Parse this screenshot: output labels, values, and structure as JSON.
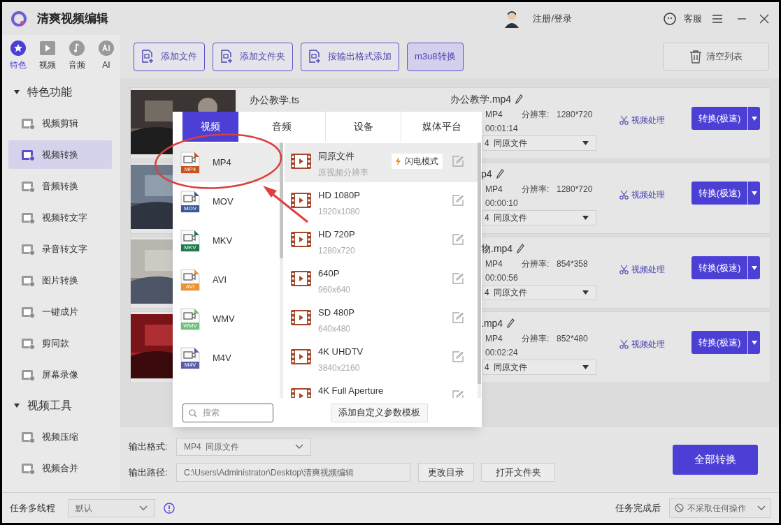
{
  "app": {
    "title": "清爽视频编辑",
    "account": "注册/登录",
    "support": "客服"
  },
  "sidebar": {
    "categories": [
      {
        "label": "特色",
        "selected": true
      },
      {
        "label": "视频",
        "selected": false
      },
      {
        "label": "音频",
        "selected": false
      },
      {
        "label": "AI",
        "selected": false
      }
    ],
    "sections": [
      {
        "title": "特色功能",
        "expanded": true,
        "items": [
          {
            "label": "视频剪辑",
            "selected": false
          },
          {
            "label": "视频转换",
            "selected": true
          },
          {
            "label": "音频转换",
            "selected": false
          },
          {
            "label": "视频转文字",
            "selected": false
          },
          {
            "label": "录音转文字",
            "selected": false
          },
          {
            "label": "图片转换",
            "selected": false
          },
          {
            "label": "一键成片",
            "selected": false
          },
          {
            "label": "剪同款",
            "selected": false
          },
          {
            "label": "屏幕录像",
            "selected": false
          }
        ]
      },
      {
        "title": "视频工具",
        "expanded": true,
        "items": [
          {
            "label": "视频压缩",
            "selected": false
          },
          {
            "label": "视频合并",
            "selected": false
          }
        ]
      }
    ]
  },
  "toolbar": {
    "buttons": [
      {
        "label": "添加文件",
        "kind": "outline"
      },
      {
        "label": "添加文件夹",
        "kind": "outline"
      },
      {
        "label": "按输出格式添加",
        "kind": "outline"
      },
      {
        "label": "m3u8转换",
        "kind": "filled"
      }
    ],
    "clear": "清空列表"
  },
  "files": [
    {
      "name": "办公教学.ts",
      "target": "办公教学.mp4",
      "format": "MP4",
      "resolution_label": "分辨率:",
      "resolution": "1280*720",
      "duration": "00:01:14",
      "preset": "4  同原文件",
      "process": "视频处理",
      "convert": "转换(极速)"
    },
    {
      "target": "p4",
      "format": "MP4",
      "resolution_label": "分辨率:",
      "resolution": "1280*720",
      "duration": "00:00:10",
      "preset": "4  同原文件",
      "process": "视频处理",
      "convert": "转换(极速)"
    },
    {
      "target": "物.mp4",
      "format": "MP4",
      "resolution_label": "分辨率:",
      "resolution": "854*358",
      "duration": "00:00:56",
      "preset": "4  同原文件",
      "process": "视频处理",
      "convert": "转换(极速)"
    },
    {
      "target": ".mp4",
      "format": "MP4",
      "resolution_label": "分辨率:",
      "resolution": "852*480",
      "duration": "00:02:24",
      "preset": "4  同原文件",
      "process": "视频处理",
      "convert": "转换(极速)"
    }
  ],
  "format_popup": {
    "tabs": [
      {
        "label": "视频",
        "selected": true
      },
      {
        "label": "音频",
        "selected": false
      },
      {
        "label": "设备",
        "selected": false
      },
      {
        "label": "媒体平台",
        "selected": false
      }
    ],
    "formats": [
      {
        "label": "MP4",
        "badge": "MP4",
        "color": "#c9531f",
        "selected": true
      },
      {
        "label": "MOV",
        "badge": "MOV",
        "color": "#3a5a9a",
        "selected": false
      },
      {
        "label": "MKV",
        "badge": "MKV",
        "color": "#1e7a4e",
        "selected": false
      },
      {
        "label": "AVI",
        "badge": "AVI",
        "color": "#f0922e",
        "selected": false
      },
      {
        "label": "WMV",
        "badge": "WMV",
        "color": "#6cc07a",
        "selected": false
      },
      {
        "label": "M4V",
        "badge": "M4V",
        "color": "#5a5ea8",
        "selected": false
      }
    ],
    "presets": [
      {
        "title": "同原文件",
        "subtitle": "原视频分辨率",
        "badge": "闪电模式",
        "selected": true
      },
      {
        "title": "HD 1080P",
        "subtitle": "1920x1080",
        "selected": false
      },
      {
        "title": "HD 720P",
        "subtitle": "1280x720",
        "selected": false
      },
      {
        "title": "640P",
        "subtitle": "960x640",
        "selected": false
      },
      {
        "title": "SD 480P",
        "subtitle": "640x480",
        "selected": false
      },
      {
        "title": "4K UHDTV",
        "subtitle": "3840x2160",
        "selected": false
      },
      {
        "title": "4K Full Aperture",
        "selected": false
      }
    ],
    "search": {
      "placeholder": "搜索"
    },
    "add_template": "添加自定义参数模板"
  },
  "output": {
    "format_label": "输出格式:",
    "format_value": "MP4  同原文件",
    "path_label": "输出路径:",
    "path_value": "C:\\Users\\Administrator\\Desktop\\清爽视频编辑",
    "change_dir": "更改目录",
    "open_folder": "打开文件夹",
    "convert_all": "全部转换"
  },
  "status_bar": {
    "threads_label": "任务多线程",
    "threads_value": "默认",
    "after_label": "任务完成后",
    "after_value": "不采取任何操作"
  }
}
